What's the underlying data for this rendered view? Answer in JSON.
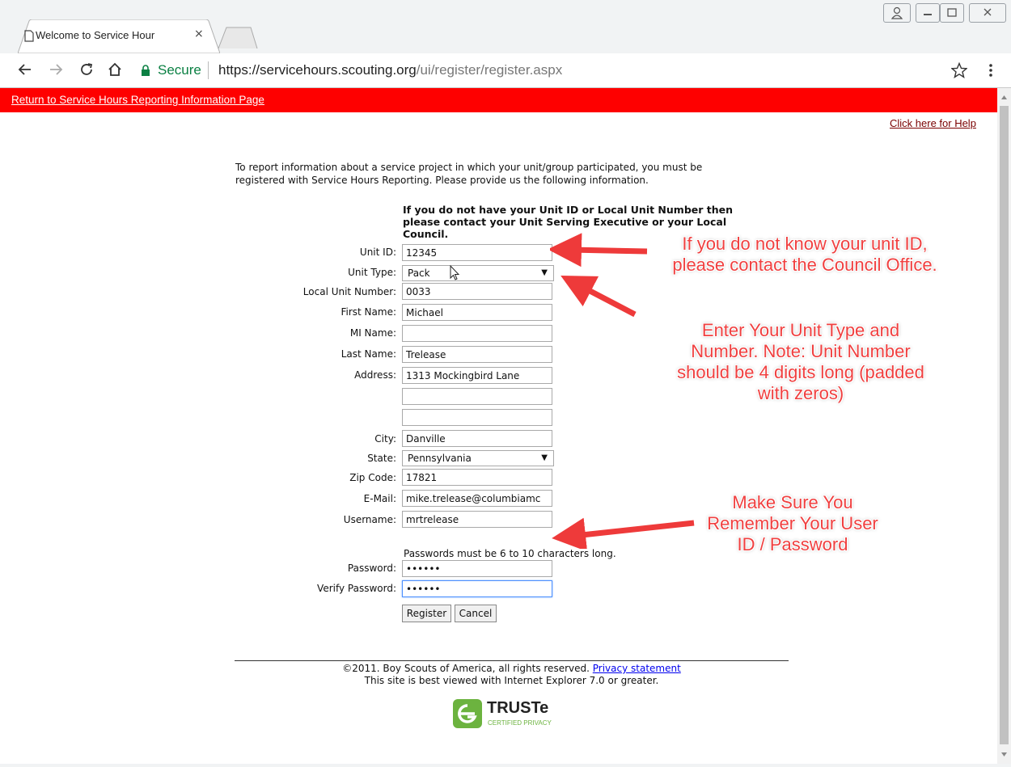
{
  "browser": {
    "tab_title": "Welcome to Service Hour",
    "tab_close": "×",
    "secure_label": "Secure",
    "url_scheme_host": "https://servicehours.scouting.org",
    "url_path": "/ui/register/register.aspx",
    "icons": [
      "back-arrow-icon",
      "forward-arrow-icon",
      "reload-icon",
      "home-icon",
      "lock-icon",
      "star-icon",
      "menu-dots-icon",
      "user-icon",
      "minimize-icon",
      "maximize-icon",
      "close-icon"
    ]
  },
  "page": {
    "return_link": "Return to Service Hours Reporting Information Page",
    "help_link": "Click here for Help",
    "intro_line1": "To report information about a service project in which your unit/group participated, you must be",
    "intro_line2": "registered with Service Hours Reporting. Please provide us the following information.",
    "notice": "If you do not have your Unit ID or Local Unit Number then please contact your Unit Serving Executive or your Local Council.",
    "password_hint": "Passwords must be 6 to 10 characters long.",
    "colors": {
      "banner": "#fe0000",
      "annotation": "#f04040"
    }
  },
  "form": {
    "unit_id": {
      "label": "Unit ID:",
      "value": "12345"
    },
    "unit_type": {
      "label": "Unit Type:",
      "value": "Pack"
    },
    "local_unit_number": {
      "label": "Local Unit Number:",
      "value": "0033"
    },
    "first_name": {
      "label": "First Name:",
      "value": "Michael"
    },
    "mi_name": {
      "label": "MI Name:",
      "value": ""
    },
    "last_name": {
      "label": "Last Name:",
      "value": "Trelease"
    },
    "address": {
      "label": "Address:",
      "value": "1313 Mockingbird Lane"
    },
    "address2": {
      "value": ""
    },
    "address3": {
      "value": ""
    },
    "city": {
      "label": "City:",
      "value": "Danville"
    },
    "state": {
      "label": "State:",
      "value": "Pennsylvania"
    },
    "zip": {
      "label": "Zip Code:",
      "value": "17821"
    },
    "email": {
      "label": "E-Mail:",
      "value": "mike.trelease@columbiamc"
    },
    "username": {
      "label": "Username:",
      "value": "mrtrelease"
    },
    "password": {
      "label": "Password:",
      "value": "••••••"
    },
    "verify_password": {
      "label": "Verify Password:",
      "value": "••••••"
    },
    "register_label": "Register",
    "cancel_label": "Cancel"
  },
  "annotations": {
    "unit_id_note_line1": "If you do not know your unit ID,",
    "unit_id_note_line2": "please contact the Council Office.",
    "unit_type_note_line1": "Enter Your Unit Type and",
    "unit_type_note_line2": "Number.  Note:  Unit Number",
    "unit_type_note_line3": "should be 4 digits long (padded",
    "unit_type_note_line4": "with zeros)",
    "password_note_line1": "Make Sure You",
    "password_note_line2": "Remember Your User",
    "password_note_line3": "ID / Password"
  },
  "footer": {
    "copyright": "©2011. Boy Scouts of America, all rights reserved.",
    "privacy_link": "Privacy statement",
    "browser_note": "This site is best viewed with Internet Explorer 7.0 or greater.",
    "truste_brand": "TRUSTe",
    "truste_sub": "CERTIFIED PRIVACY"
  }
}
